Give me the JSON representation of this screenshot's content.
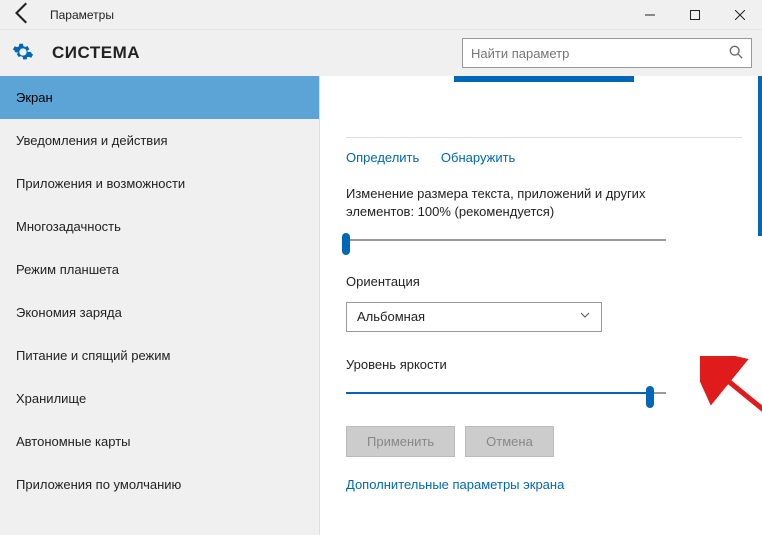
{
  "titlebar": {
    "title": "Параметры"
  },
  "section": {
    "title": "СИСТЕМА"
  },
  "search": {
    "placeholder": "Найти параметр"
  },
  "sidebar": {
    "items": [
      {
        "label": "Экран",
        "selected": true
      },
      {
        "label": "Уведомления и действия"
      },
      {
        "label": "Приложения и возможности"
      },
      {
        "label": "Многозадачность"
      },
      {
        "label": "Режим планшета"
      },
      {
        "label": "Экономия заряда"
      },
      {
        "label": "Питание и спящий режим"
      },
      {
        "label": "Хранилище"
      },
      {
        "label": "Автономные карты"
      },
      {
        "label": "Приложения по умолчанию"
      }
    ]
  },
  "main": {
    "detect_link": "Определить",
    "identify_link": "Обнаружить",
    "scale_label": "Изменение размера текста, приложений и других элементов: 100% (рекомендуется)",
    "scale_value_percent": 0,
    "orientation_label": "Ориентация",
    "orientation_value": "Альбомная",
    "brightness_label": "Уровень яркости",
    "brightness_value_percent": 95,
    "apply_button": "Применить",
    "cancel_button": "Отмена",
    "advanced_link": "Дополнительные параметры экрана"
  }
}
